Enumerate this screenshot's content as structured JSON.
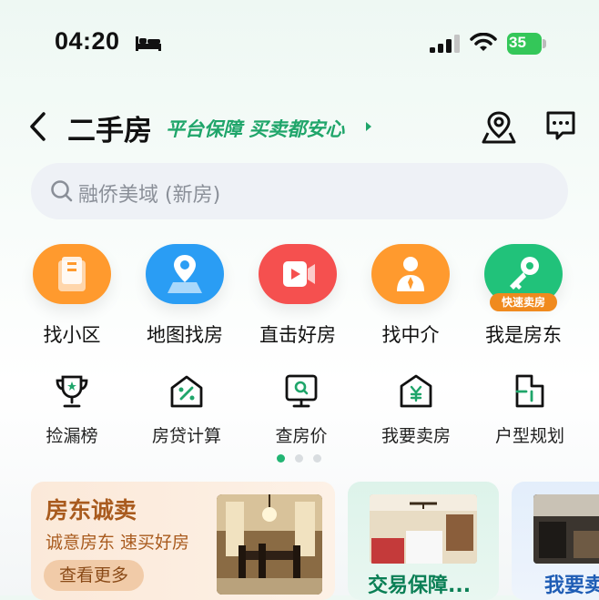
{
  "status_bar": {
    "time": "04:20",
    "battery": "35"
  },
  "header": {
    "title": "二手房",
    "slogan": "平台保障 买卖都安心",
    "icons": [
      "back-icon",
      "location-icon",
      "message-icon"
    ]
  },
  "search": {
    "placeholder": "融侨美域 (新房)"
  },
  "main_icons": [
    {
      "label": "找小区",
      "icon": "building-icon",
      "color": "#ff9a2e"
    },
    {
      "label": "地图找房",
      "icon": "map-pin-icon",
      "color": "#2a9df4"
    },
    {
      "label": "直击好房",
      "icon": "video-icon",
      "color": "#f5504f"
    },
    {
      "label": "找中介",
      "icon": "agent-icon",
      "color": "#ff9a2e"
    },
    {
      "label": "我是房东",
      "icon": "key-icon",
      "color": "#21c27a",
      "badge": "快速卖房"
    }
  ],
  "tools": [
    {
      "label": "捡漏榜",
      "icon": "trophy-icon"
    },
    {
      "label": "房贷计算",
      "icon": "percent-house-icon"
    },
    {
      "label": "查房价",
      "icon": "price-search-icon"
    },
    {
      "label": "我要卖房",
      "icon": "sell-house-icon"
    },
    {
      "label": "户型规划",
      "icon": "floorplan-icon"
    }
  ],
  "pager": {
    "pages": 3,
    "active": 1
  },
  "cards": {
    "landlord": {
      "title": "房东诚卖",
      "subtitle": "诚意房东 速买好房",
      "button": "查看更多"
    },
    "guarantee": {
      "title": "交易保障..."
    },
    "sell": {
      "title": "我要卖"
    }
  },
  "colors": {
    "accent": "#1fa56a",
    "orange": "#f08a1e"
  }
}
